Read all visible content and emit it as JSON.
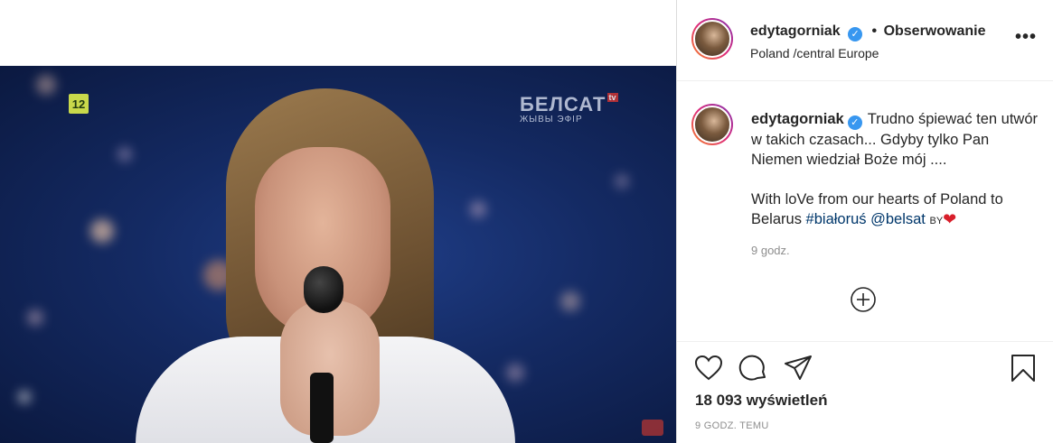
{
  "video": {
    "channel_badge": "12",
    "watermark_main": "БЕЛСАТ",
    "watermark_tv": "tv",
    "watermark_sub": "ЖЫВЫ ЭФІР"
  },
  "header": {
    "username": "edytagorniak",
    "verified_icon": "verified-badge-icon",
    "separator": "•",
    "follow_label": "Obserwowanie",
    "location": "Poland /central Europe",
    "more_label": "•••"
  },
  "comment": {
    "username": "edytagorniak",
    "text_line1": "Trudno śpiewać ten utwór w takich czasach... Gdyby tylko Pan Niemen wiedział Boże mój ....",
    "text_line2": "With loVe from our hearts of Poland to Belarus",
    "hashtag": "#białoruś",
    "mention": "@belsat",
    "by_text": "BY",
    "heart": "❤",
    "time_ago": "9 godz."
  },
  "stats": {
    "views": "18 093 wyświetleń",
    "timestamp": "9 GODZ. TEMU"
  },
  "colors": {
    "link": "#00376b",
    "verified": "#3897f0",
    "muted": "#8e8e8e",
    "heart": "#d81f2b"
  }
}
